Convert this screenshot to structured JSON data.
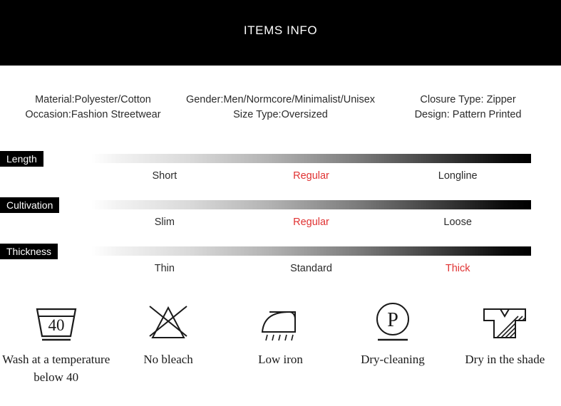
{
  "header": {
    "title": "ITEMS INFO"
  },
  "info": {
    "columns": [
      {
        "lines": [
          "Material:Polyester/Cotton",
          "Occasion:Fashion Streetwear"
        ]
      },
      {
        "lines": [
          "Gender:Men/Normcore/Minimalist/Unisex",
          "Size Type:Oversized"
        ]
      },
      {
        "lines": [
          "Closure Type: Zipper",
          "Design: Pattern Printed"
        ]
      }
    ]
  },
  "scales": [
    {
      "tag": "Length",
      "labels": [
        "Short",
        "Regular",
        "Longline"
      ],
      "selected_index": 1
    },
    {
      "tag": "Cultivation",
      "labels": [
        "Slim",
        "Regular",
        "Loose"
      ],
      "selected_index": 1
    },
    {
      "tag": "Thickness",
      "labels": [
        "Thin",
        "Standard",
        "Thick"
      ],
      "selected_index": 2
    }
  ],
  "care": {
    "items": [
      {
        "icon": "wash-tub-40-icon",
        "value": "40",
        "caption": "Wash at a temperature below 40"
      },
      {
        "icon": "no-bleach-triangle-crossed-icon",
        "caption": "No bleach"
      },
      {
        "icon": "low-iron-icon",
        "caption": "Low iron"
      },
      {
        "icon": "dry-cleaning-circle-p-icon",
        "value": "P",
        "caption": "Dry-cleaning"
      },
      {
        "icon": "dry-in-shade-tshirt-icon",
        "caption": "Dry in the shade"
      }
    ]
  },
  "colors": {
    "banner_background": "#000000",
    "banner_text": "#ffffff",
    "highlight": "#e03232",
    "body_text": "#2b2b2b",
    "gradient_start": "#ffffff",
    "gradient_end": "#000000"
  }
}
